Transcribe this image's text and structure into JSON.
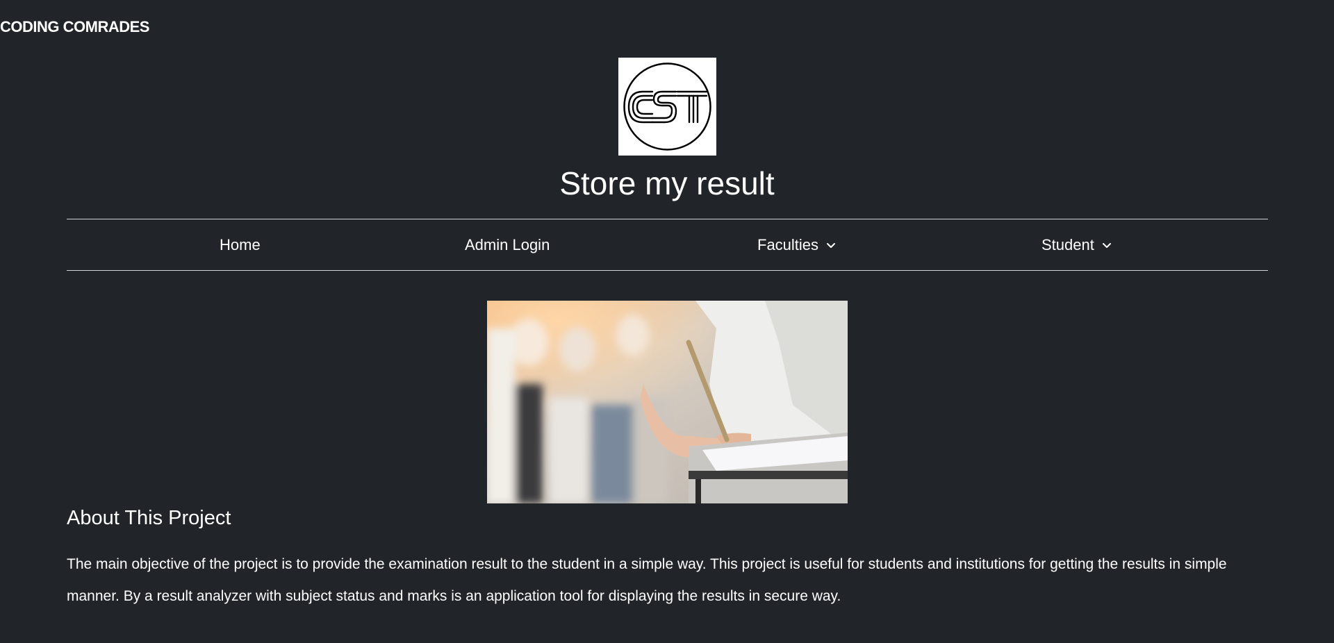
{
  "brand": {
    "name": "CODING COMRADES"
  },
  "logo": {
    "text": "CST"
  },
  "header": {
    "title": "Store my result"
  },
  "nav": {
    "items": [
      {
        "label": "Home"
      },
      {
        "label": "Admin Login"
      },
      {
        "label": "Faculties"
      },
      {
        "label": "Student"
      }
    ]
  },
  "hero": {
    "alt": "Students writing an examination"
  },
  "about": {
    "heading": "About This Project",
    "body": "The main objective of the project is to provide the examination result to the student in a simple way. This project is useful for students and institutions for getting the results in simple manner. By a result analyzer with subject status and marks is an application tool for displaying the results in secure way."
  },
  "colors": {
    "background": "#212529",
    "text": "#ffffff",
    "divider": "#cfd2d6"
  }
}
